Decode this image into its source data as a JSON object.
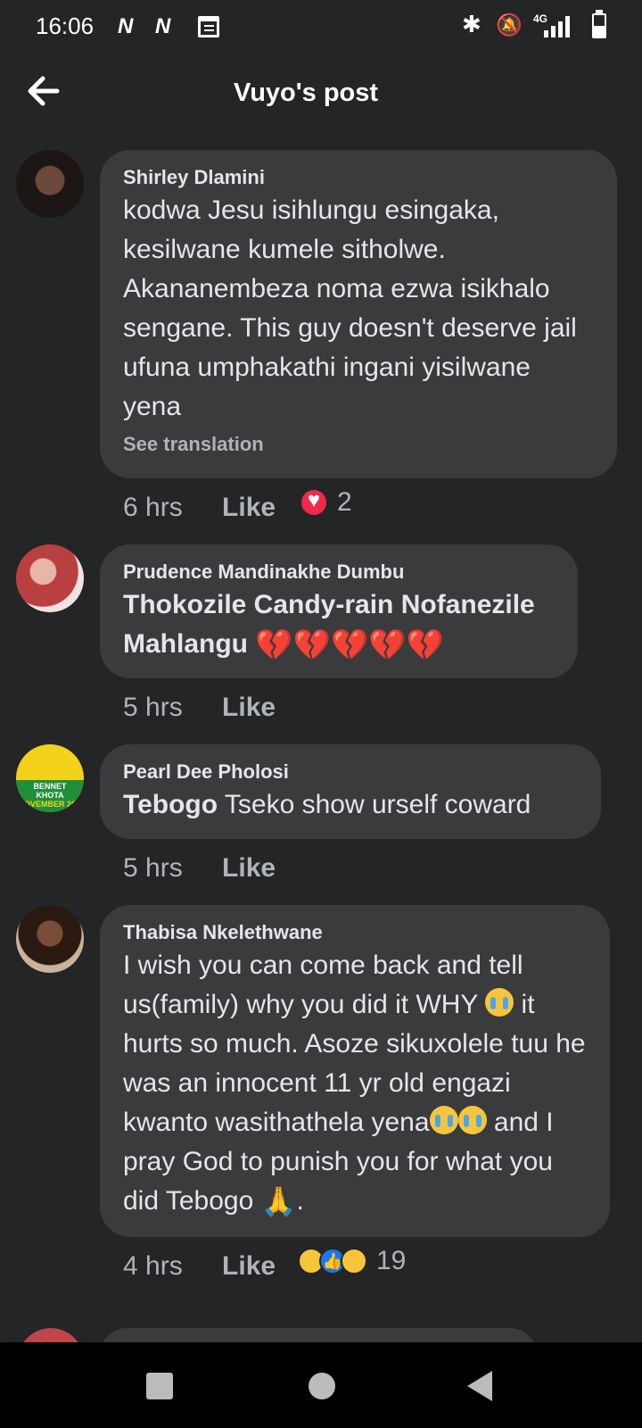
{
  "status_bar": {
    "time": "16:06",
    "notif_1": "N",
    "notif_2": "N",
    "network": "4G"
  },
  "header": {
    "title": "Vuyo's post"
  },
  "comments": [
    {
      "author": "Shirley Dlamini",
      "text": "kodwa Jesu isihlungu esingaka, kesilwane kumele sitholwe. Akananembeza noma ezwa isikhalo sengane. This guy doesn't deserve jail ufuna umphakathi ingani yisilwane yena",
      "translate": "See translation",
      "time": "6 hrs",
      "like": "Like",
      "reaction_count": "2"
    },
    {
      "author": "Prudence Mandinakhe Dumbu",
      "tag": "Thokozile Candy-rain Nofanezile Mahlangu",
      "time": "5 hrs",
      "like": "Like"
    },
    {
      "author": "Pearl Dee Pholosi",
      "tag": "Tebogo",
      "text": " Tseko show urself coward",
      "avatar_text_1": "BENNET",
      "avatar_text_2": "KHOTA",
      "avatar_text_3": "OVEMBER 20",
      "time": "5 hrs",
      "like": "Like"
    },
    {
      "author": "Thabisa Nkelethwane",
      "text_1": "I wish you can come back and tell us(family) why you did it WHY ",
      "text_2": " it hurts so much. Asoze sikuxolele tuu he was an innocent 11 yr old engazi kwanto wasithathela yena",
      "text_3": " and I pray God to punish you for what you did Tebogo ",
      "text_4": ".",
      "time": "4 hrs",
      "like": "Like",
      "reaction_count": "19"
    }
  ]
}
